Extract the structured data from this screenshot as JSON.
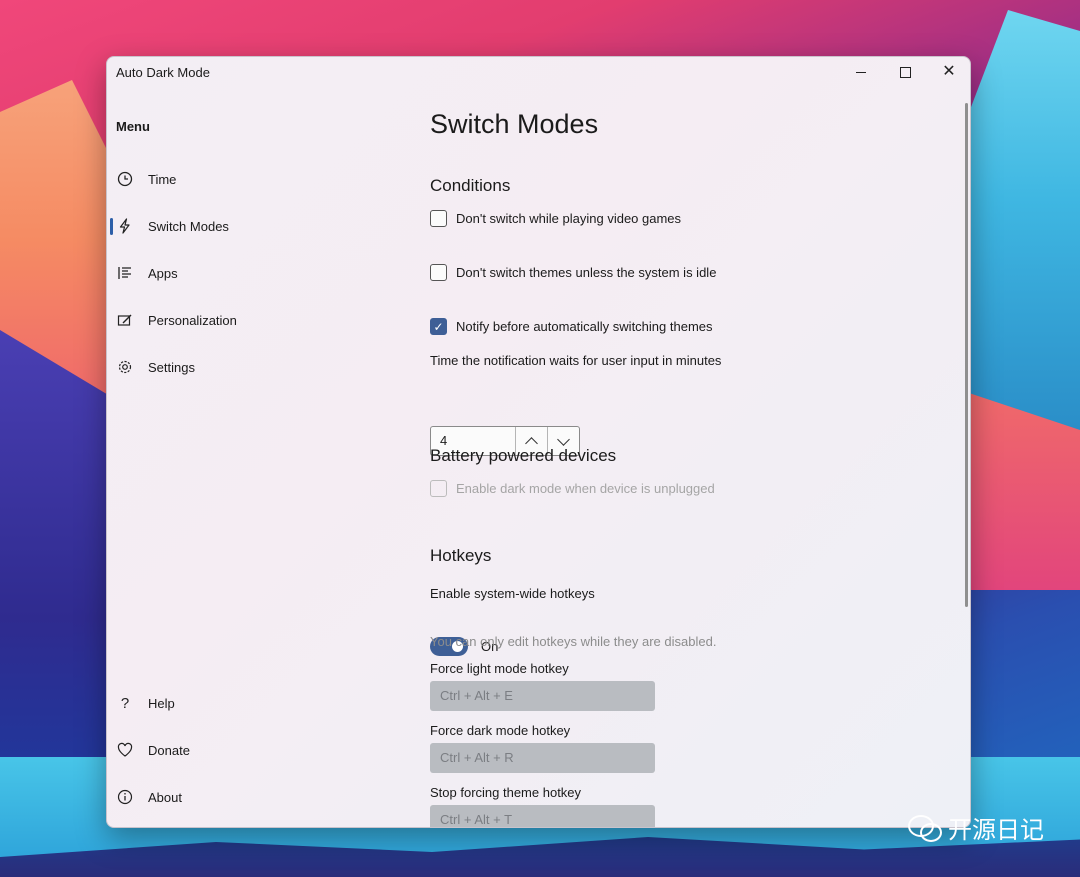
{
  "window": {
    "title": "Auto Dark Mode"
  },
  "sidebar": {
    "menu_title": "Menu",
    "items": [
      {
        "label": "Time",
        "icon": "clock-icon"
      },
      {
        "label": "Switch Modes",
        "icon": "lightning-icon",
        "selected": true
      },
      {
        "label": "Apps",
        "icon": "list-icon"
      },
      {
        "label": "Personalization",
        "icon": "paint-icon"
      },
      {
        "label": "Settings",
        "icon": "gear-icon"
      }
    ],
    "footer_items": [
      {
        "label": "Help",
        "icon": "question-icon"
      },
      {
        "label": "Donate",
        "icon": "heart-icon"
      },
      {
        "label": "About",
        "icon": "info-icon"
      }
    ]
  },
  "main": {
    "page_title": "Switch Modes",
    "conditions": {
      "title": "Conditions",
      "options": [
        {
          "label": "Don't switch while playing video games",
          "checked": false
        },
        {
          "label": "Don't switch themes unless the system is idle",
          "checked": false
        },
        {
          "label": "Notify before automatically switching themes",
          "checked": true
        }
      ],
      "wait_label": "Time the notification waits for user input in minutes",
      "wait_value": "4"
    },
    "battery": {
      "title": "Battery powered devices",
      "option_label": "Enable dark mode when device is unplugged",
      "checked": false,
      "disabled": true
    },
    "hotkeys": {
      "title": "Hotkeys",
      "enable_label": "Enable system-wide hotkeys",
      "toggle_state": "On",
      "hint": "You can only edit hotkeys while they are disabled.",
      "light_label": "Force light mode hotkey",
      "light_value": "Ctrl + Alt + E",
      "dark_label": "Force dark mode hotkey",
      "dark_value": "Ctrl + Alt + R",
      "stop_label": "Stop forcing theme hotkey",
      "stop_value": "Ctrl + Alt + T"
    }
  },
  "watermark": {
    "text": "开源日记"
  },
  "colors": {
    "accent": "#3e5f96",
    "window_bg": "#f3eef4",
    "disabled_field": "#b9bcc1"
  }
}
